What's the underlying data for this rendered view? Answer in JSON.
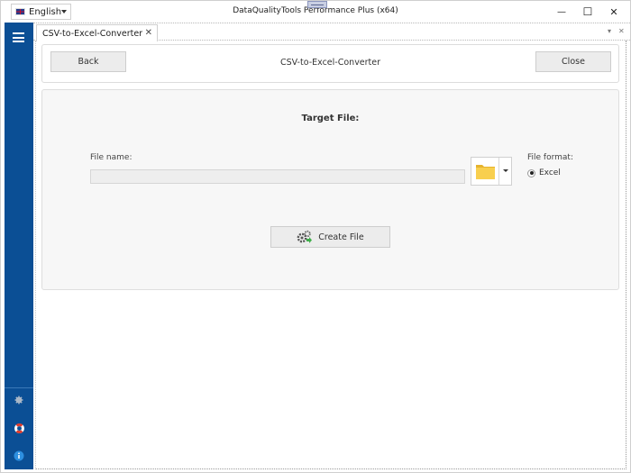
{
  "titlebar": {
    "language": "English",
    "app_title": "DataQualityTools Performance Plus (x64)",
    "minimize_glyph": "—",
    "maximize_glyph": "☐",
    "close_glyph": "✕"
  },
  "tabs": [
    {
      "label": "CSV-to-Excel-Converter",
      "close_glyph": "✕",
      "active": true
    }
  ],
  "tabstrip": {
    "dropdown_glyph": "▾",
    "close_glyph": "✕"
  },
  "header": {
    "back_label": "Back",
    "title": "CSV-to-Excel-Converter",
    "close_label": "Close"
  },
  "form": {
    "section_title": "Target File:",
    "file_name_label": "File name:",
    "file_name_value": "",
    "file_format_label": "File format:",
    "file_format_options": [
      {
        "label": "Excel",
        "selected": true
      }
    ],
    "create_button_label": "Create File"
  },
  "sidebar": {
    "items": [
      {
        "icon": "menu-icon"
      },
      {
        "icon": "gear-icon"
      },
      {
        "icon": "lifebuoy-icon"
      },
      {
        "icon": "info-icon"
      }
    ]
  },
  "colors": {
    "sidebar": "#0b4f95",
    "folder": "#f5c542",
    "info": "#2d8fe0",
    "lifebuoy": "#e0392a"
  }
}
